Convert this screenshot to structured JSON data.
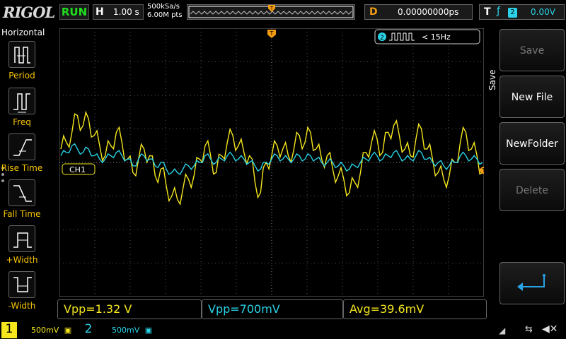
{
  "brand": "RIGOL",
  "status": {
    "run": "RUN"
  },
  "horizontal": {
    "label": "H",
    "timebase": "1.00 s",
    "sample_rate": "500kSa/s",
    "memory_depth": "6.00M pts"
  },
  "delay": {
    "label": "D",
    "value": "0.00000000ps"
  },
  "trigger": {
    "label": "T",
    "source": "2",
    "level": "0.00V"
  },
  "left_menu": {
    "title": "Horizontal",
    "items": [
      {
        "label": "Period",
        "icon": "period-icon"
      },
      {
        "label": "Freq",
        "icon": "frequency-icon"
      },
      {
        "label": "Rise Time",
        "icon": "rise-time-icon"
      },
      {
        "label": "Fall Time",
        "icon": "fall-time-icon"
      },
      {
        "label": "+Width",
        "icon": "positive-width-icon"
      },
      {
        "label": "-Width",
        "icon": "negative-width-icon"
      }
    ]
  },
  "right_menu": {
    "tab": "Save",
    "buttons": [
      {
        "label": "Save",
        "enabled": false
      },
      {
        "label": "New File",
        "enabled": true
      },
      {
        "label": "NewFolder",
        "enabled": true
      },
      {
        "label": "Delete",
        "enabled": false
      },
      {
        "label": "",
        "icon": "return-icon",
        "enabled": true
      }
    ]
  },
  "screen": {
    "ch1_marker": "1",
    "ch1_label": "CH1",
    "trigger_marker": "T",
    "freq_badge": {
      "channel": "2",
      "text": "< 15Hz"
    }
  },
  "measurements": [
    {
      "text": "Vpp=1.32 V",
      "color": "#f5e61e"
    },
    {
      "text": "Vpp=700mV",
      "color": "#29d2e6"
    },
    {
      "text": "Avg=39.6mV",
      "color": "#f5e61e"
    }
  ],
  "channels": [
    {
      "number": "1",
      "scale": "500mV",
      "color": "#f5e61e"
    },
    {
      "number": "2",
      "scale": "500mV",
      "color": "#29d2e6"
    }
  ],
  "colors": {
    "ch1": "#f5e61e",
    "ch2": "#29d2e6",
    "trigger": "#f39c12",
    "run": "#1ee01e"
  },
  "chart_data": {
    "type": "line",
    "series": [
      {
        "values": [
          0.4,
          0.6,
          0.9,
          1.4,
          1.1,
          1.3,
          0.8,
          0.5,
          0.2,
          0.5,
          0.9,
          0.6,
          0.1,
          -0.3,
          0.1,
          0.4,
          0.2,
          -0.4,
          -0.2,
          -0.7,
          -1.0,
          -1.1,
          -0.8,
          -0.5,
          -0.4,
          0.1,
          0.5,
          0.2,
          -0.3,
          0.2,
          0.6,
          0.8,
          0.5,
          0.3,
          0.2,
          -0.6,
          -0.9,
          0.0,
          0.2,
          0.5,
          0.4,
          0.2,
          0.4,
          0.8,
          0.6,
          0.9,
          0.4,
          0.1,
          0.2,
          -0.2,
          -0.4,
          -0.5,
          -0.9,
          -0.6,
          -0.3,
          0.3,
          0.6,
          0.7,
          0.3,
          0.9,
          1.1,
          0.8,
          0.4,
          0.2,
          0.7,
          1.0,
          0.4,
          0.1,
          -0.3,
          -0.5,
          -0.4,
          0.0,
          0.6,
          0.9,
          0.4,
          0.2,
          -0.3
        ]
      },
      {
        "values": [
          0.2,
          0.3,
          0.5,
          0.4,
          0.3,
          0.4,
          0.2,
          0.1,
          0.1,
          0.2,
          0.3,
          0.2,
          0.1,
          -0.1,
          0.1,
          0.2,
          0.1,
          -0.1,
          0.0,
          -0.2,
          -0.3,
          -0.3,
          -0.2,
          -0.1,
          -0.1,
          0.0,
          0.2,
          0.1,
          0.0,
          0.1,
          0.2,
          0.2,
          0.1,
          0.1,
          0.0,
          -0.1,
          -0.2,
          0.0,
          0.1,
          0.2,
          0.1,
          0.1,
          0.1,
          0.2,
          0.1,
          0.2,
          0.1,
          0.0,
          0.0,
          0.0,
          -0.1,
          -0.1,
          -0.2,
          -0.1,
          0.0,
          0.1,
          0.2,
          0.2,
          0.1,
          0.2,
          0.3,
          0.2,
          0.1,
          0.1,
          0.2,
          0.3,
          0.1,
          0.0,
          0.0,
          -0.1,
          -0.1,
          0.0,
          0.2,
          0.2,
          0.1,
          0.1,
          0.0
        ]
      }
    ],
    "xlim": [
      -7.0,
      7.0
    ],
    "ylim": [
      -2.0,
      2.0
    ],
    "grid": true
  }
}
